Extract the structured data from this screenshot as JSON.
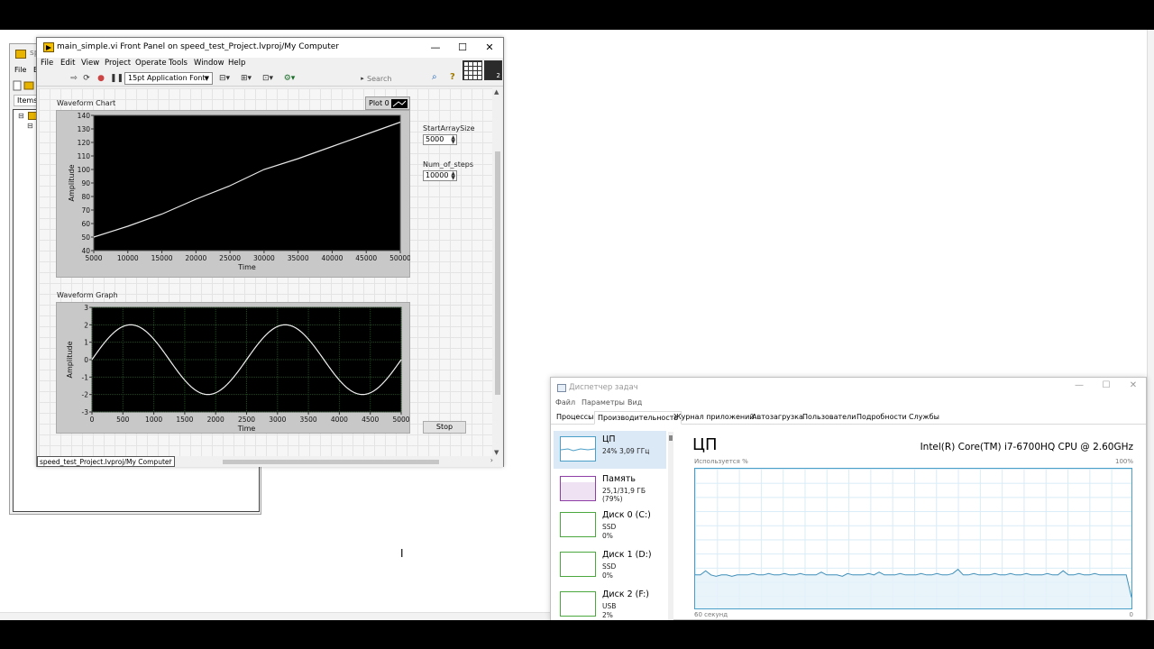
{
  "project_window": {
    "title": "sp",
    "menu_file": "File",
    "menu_edit": "E",
    "tab_items": "Items"
  },
  "front_panel": {
    "title": "main_simple.vi Front Panel on speed_test_Project.lvproj/My Computer",
    "menu": [
      "File",
      "Edit",
      "View",
      "Project",
      "Operate",
      "Tools",
      "Window",
      "Help"
    ],
    "font_select": "15pt Application Font",
    "search_placeholder": "Search",
    "connector_number": "2",
    "status_path": "speed_test_Project.lvproj/My Computer",
    "controls": {
      "start_array_size_label": "StartArraySize",
      "start_array_size_value": "5000",
      "num_steps_label": "Num_of_steps",
      "num_steps_value": "10000",
      "stop_label": "Stop"
    },
    "plot_legend": "Plot 0"
  },
  "chart_data": [
    {
      "type": "line",
      "title": "Waveform Chart",
      "xlabel": "Time",
      "ylabel": "Amplitude",
      "xlim": [
        5000,
        50000
      ],
      "ylim": [
        40,
        140
      ],
      "xticks": [
        5000,
        10000,
        15000,
        20000,
        25000,
        30000,
        35000,
        40000,
        45000,
        50000
      ],
      "yticks": [
        40,
        50,
        60,
        70,
        80,
        90,
        100,
        110,
        120,
        130,
        140
      ],
      "background": "#000000",
      "line_color": "#e8e8e8",
      "series": [
        {
          "x": [
            5000,
            10000,
            15000,
            20000,
            25000,
            30000,
            35000,
            40000,
            45000,
            50000
          ],
          "y": [
            50,
            58,
            67,
            78,
            88,
            100,
            108,
            117,
            126,
            135
          ]
        }
      ]
    },
    {
      "type": "line",
      "title": "Waveform Graph",
      "xlabel": "Time",
      "ylabel": "Amplitude",
      "xlim": [
        0,
        5000
      ],
      "ylim": [
        -3,
        3
      ],
      "xticks": [
        0,
        500,
        1000,
        1500,
        2000,
        2500,
        3000,
        3500,
        4000,
        4500,
        5000
      ],
      "yticks": [
        -3,
        -2,
        -1,
        0,
        1,
        2,
        3
      ],
      "background": "#000000",
      "grid": true,
      "grid_color": "#1f4a1f",
      "line_color": "#f0f0f0",
      "function": "sine",
      "amplitude": 2,
      "period": 2500,
      "samples": 5001
    }
  ],
  "task_manager": {
    "title": "Диспетчер задач",
    "menu": [
      "Файл",
      "Параметры",
      "Вид"
    ],
    "tabs": [
      "Процессы",
      "Производительность",
      "Журнал приложений",
      "Автозагрузка",
      "Пользователи",
      "Подробности",
      "Службы"
    ],
    "active_tab": 1,
    "resources": [
      {
        "name": "ЦП",
        "line1": "24%  3,09 ГГц",
        "line2": "",
        "color": "#4a9fc8"
      },
      {
        "name": "Память",
        "line1": "25,1/31,9 ГБ (79%)",
        "line2": "",
        "color": "#8e3ea6"
      },
      {
        "name": "Диск 0 (C:)",
        "line1": "SSD",
        "line2": "0%",
        "color": "#4aa83f"
      },
      {
        "name": "Диск 1 (D:)",
        "line1": "SSD",
        "line2": "0%",
        "color": "#4aa83f"
      },
      {
        "name": "Диск 2 (F:)",
        "line1": "USB",
        "line2": "2%",
        "color": "#4aa83f"
      }
    ],
    "cpu_header": "ЦП",
    "cpu_model": "Intel(R) Core(TM) i7-6700HQ CPU @ 2.60GHz",
    "utilization_label": "Используется %",
    "utilization_max": "100%",
    "time_span_label": "60 секунд",
    "time_end_label": "0",
    "cpu_history": [
      24,
      24,
      27,
      24,
      23,
      24,
      24,
      23,
      24,
      24,
      24,
      25,
      24,
      24,
      25,
      24,
      24,
      25,
      24,
      24,
      25,
      24,
      24,
      24,
      26,
      24,
      24,
      24,
      23,
      25,
      24,
      24,
      24,
      25,
      24,
      26,
      24,
      24,
      24,
      25,
      24,
      24,
      24,
      25,
      24,
      24,
      25,
      24,
      24,
      25,
      28,
      24,
      24,
      25,
      24,
      24,
      24,
      25,
      24,
      24,
      25,
      24,
      24,
      25,
      24,
      24,
      24,
      25,
      24,
      24,
      27,
      24,
      24,
      25,
      24,
      24,
      25,
      24,
      24,
      24,
      24,
      24,
      24,
      8
    ]
  }
}
